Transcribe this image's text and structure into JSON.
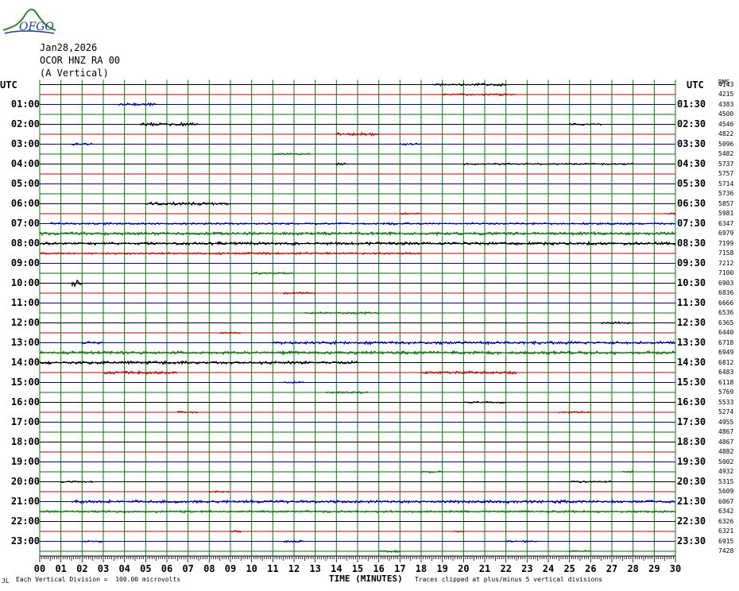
{
  "logo": {
    "text": "OFGO",
    "icon": "ofgo-mountain-logo"
  },
  "header": {
    "date": "Jan28,2026",
    "station": "OCOR HNZ RA 00",
    "component": "(A Vertical)"
  },
  "utc_label_left": "UTC",
  "utc_label_right": "UTC",
  "rms_header": "RMS",
  "footer": {
    "division": "Each Vertical Division =  100.00 microvolts",
    "xlabel": "TIME (MINUTES)",
    "clip_note": "Traces clipped at plus/minus 5 vertical divisions"
  },
  "colors": {
    "grid": "#008000",
    "trace_cycle": [
      "#000000",
      "#cc0000",
      "#0000cc",
      "#007700"
    ]
  },
  "chart_data": {
    "type": "line",
    "title": "",
    "xlabel": "TIME (MINUTES)",
    "ylabel": "",
    "x_ticks": [
      "00",
      "01",
      "02",
      "03",
      "04",
      "05",
      "06",
      "07",
      "08",
      "09",
      "10",
      "11",
      "12",
      "13",
      "14",
      "15",
      "16",
      "17",
      "18",
      "19",
      "20",
      "21",
      "22",
      "23",
      "24",
      "25",
      "26",
      "27",
      "28",
      "29",
      "30"
    ],
    "xlim": [
      0,
      30
    ],
    "grid": true,
    "left_hour_labels": [
      "01:00",
      "02:00",
      "03:00",
      "04:00",
      "05:00",
      "06:00",
      "07:00",
      "08:00",
      "09:00",
      "10:00",
      "11:00",
      "12:00",
      "13:00",
      "14:00",
      "15:00",
      "16:00",
      "17:00",
      "18:00",
      "19:00",
      "20:00",
      "21:00",
      "22:00",
      "23:00"
    ],
    "right_hour_labels": [
      "01:30",
      "02:30",
      "03:30",
      "04:30",
      "05:30",
      "06:30",
      "07:30",
      "08:30",
      "09:30",
      "10:30",
      "11:30",
      "12:30",
      "13:30",
      "14:30",
      "15:30",
      "16:30",
      "17:30",
      "18:30",
      "19:30",
      "20:30",
      "21:30",
      "22:30",
      "23:30"
    ],
    "rms_values": [
      "4143",
      "4215",
      "4383",
      "4500",
      "4546",
      "4822",
      "5096",
      "5482",
      "5737",
      "5757",
      "5714",
      "5736",
      "5857",
      "5981",
      "6347",
      "6979",
      "7199",
      "7158",
      "7212",
      "7100",
      "6903",
      "6836",
      "6666",
      "6536",
      "6365",
      "6440",
      "6718",
      "6949",
      "6812",
      "6483",
      "6118",
      "5769",
      "5533",
      "5274",
      "4955",
      "4867",
      "4867",
      "4882",
      "5002",
      "4932",
      "5315",
      "5609",
      "6067",
      "6342",
      "6326",
      "6321",
      "6915",
      "7428"
    ],
    "trace_bursts": [
      {
        "row": 0,
        "segments": [
          [
            18.5,
            20.5,
            1
          ],
          [
            20.5,
            22.0,
            1.5
          ]
        ]
      },
      {
        "row": 1,
        "segments": [
          [
            19.0,
            22.5,
            1
          ]
        ]
      },
      {
        "row": 2,
        "segments": [
          [
            3.7,
            5.5,
            1.5
          ]
        ]
      },
      {
        "row": 4,
        "segments": [
          [
            4.7,
            7.5,
            1.5
          ],
          [
            25.0,
            26.5,
            1
          ]
        ]
      },
      {
        "row": 5,
        "segments": [
          [
            14.0,
            16.0,
            1.5
          ]
        ]
      },
      {
        "row": 6,
        "segments": [
          [
            1.5,
            2.5,
            1
          ],
          [
            17.0,
            18.0,
            1
          ]
        ]
      },
      {
        "row": 7,
        "segments": [
          [
            11.0,
            12.8,
            1
          ]
        ]
      },
      {
        "row": 8,
        "segments": [
          [
            14.0,
            14.5,
            1
          ],
          [
            20.0,
            28.0,
            0.8
          ]
        ]
      },
      {
        "row": 12,
        "segments": [
          [
            5.0,
            9.0,
            1.5
          ]
        ]
      },
      {
        "row": 13,
        "segments": [
          [
            17.0,
            18.0,
            1
          ],
          [
            29.5,
            30.0,
            1
          ]
        ]
      },
      {
        "row": 14,
        "segments": [
          [
            0.5,
            30.0,
            1
          ]
        ]
      },
      {
        "row": 15,
        "segments": [
          [
            0.0,
            30.0,
            1.5
          ]
        ]
      },
      {
        "row": 16,
        "segments": [
          [
            0.0,
            30.0,
            1.5
          ]
        ]
      },
      {
        "row": 17,
        "segments": [
          [
            0.0,
            18.0,
            1
          ]
        ]
      },
      {
        "row": 19,
        "segments": [
          [
            10.0,
            12.0,
            1
          ]
        ]
      },
      {
        "row": 20,
        "segments": [
          [
            1.5,
            2.0,
            3
          ]
        ]
      },
      {
        "row": 21,
        "segments": [
          [
            11.5,
            13.0,
            1
          ]
        ]
      },
      {
        "row": 23,
        "segments": [
          [
            12.5,
            16.0,
            1
          ]
        ]
      },
      {
        "row": 24,
        "segments": [
          [
            26.5,
            28.0,
            1
          ]
        ]
      },
      {
        "row": 25,
        "segments": [
          [
            8.5,
            9.5,
            1
          ]
        ]
      },
      {
        "row": 26,
        "segments": [
          [
            2.0,
            3.0,
            1.5
          ],
          [
            11.0,
            30.0,
            1.5
          ]
        ]
      },
      {
        "row": 27,
        "segments": [
          [
            0.0,
            30.0,
            1.5
          ]
        ]
      },
      {
        "row": 28,
        "segments": [
          [
            0.0,
            15.0,
            1.5
          ]
        ]
      },
      {
        "row": 29,
        "segments": [
          [
            3.0,
            6.5,
            1.5
          ],
          [
            18.0,
            22.5,
            1.5
          ]
        ]
      },
      {
        "row": 30,
        "segments": [
          [
            11.5,
            12.5,
            1
          ]
        ]
      },
      {
        "row": 31,
        "segments": [
          [
            13.5,
            15.5,
            1
          ]
        ]
      },
      {
        "row": 32,
        "segments": [
          [
            20.0,
            22.0,
            1
          ]
        ]
      },
      {
        "row": 33,
        "segments": [
          [
            6.5,
            7.5,
            1
          ],
          [
            24.5,
            26.0,
            1
          ]
        ]
      },
      {
        "row": 39,
        "segments": [
          [
            18.0,
            19.0,
            1
          ],
          [
            27.5,
            28.0,
            1
          ]
        ]
      },
      {
        "row": 40,
        "segments": [
          [
            1.0,
            2.5,
            1
          ],
          [
            25.0,
            27.0,
            1
          ]
        ]
      },
      {
        "row": 41,
        "segments": [
          [
            8.0,
            9.0,
            1
          ]
        ]
      },
      {
        "row": 42,
        "segments": [
          [
            1.5,
            30.0,
            1.5
          ]
        ]
      },
      {
        "row": 43,
        "segments": [
          [
            0.0,
            30.0,
            1
          ]
        ]
      },
      {
        "row": 45,
        "segments": [
          [
            9.0,
            9.5,
            1
          ],
          [
            19.5,
            20.0,
            1
          ]
        ]
      },
      {
        "row": 46,
        "segments": [
          [
            2.0,
            3.0,
            1
          ],
          [
            11.5,
            12.5,
            1
          ],
          [
            22.0,
            23.5,
            1
          ]
        ]
      },
      {
        "row": 47,
        "segments": [
          [
            16.0,
            17.0,
            1
          ],
          [
            25.0,
            26.0,
            1
          ]
        ]
      }
    ]
  }
}
